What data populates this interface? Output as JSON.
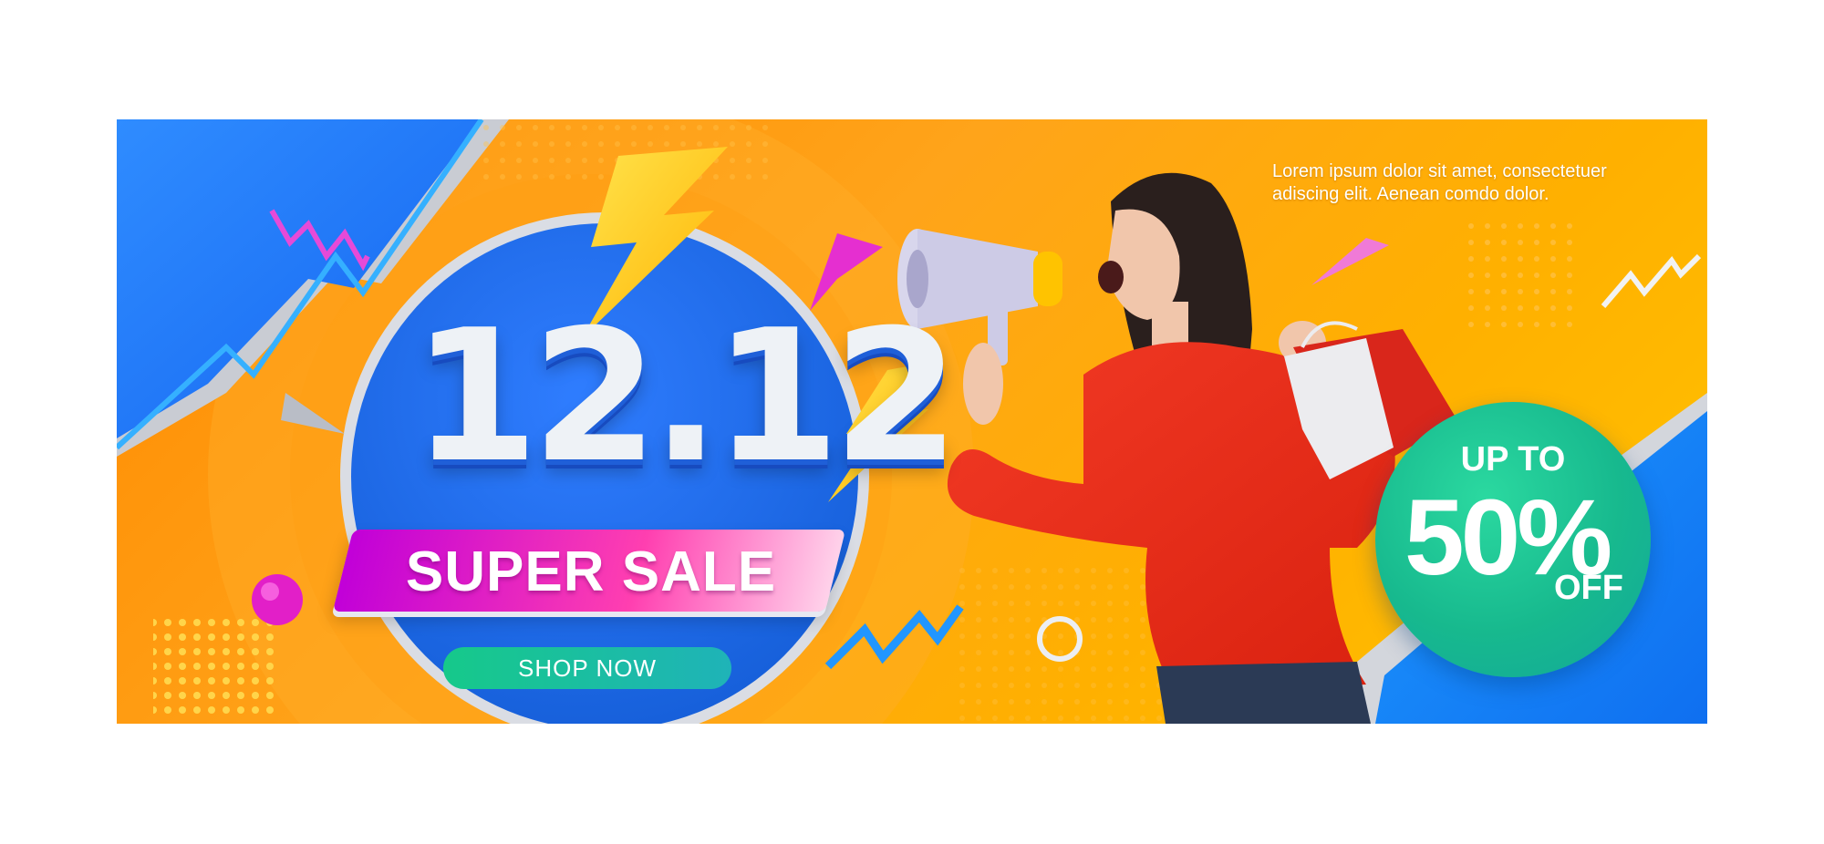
{
  "banner": {
    "lorem_text": "Lorem ipsum dolor sit amet, consectetuer adiscing elit. Aenean comdo dolor.",
    "date_text": "12.12",
    "sale_label": "SUPER SALE",
    "shop_button_label": "SHOP NOW",
    "promo": {
      "prefix": "UP TO",
      "percent": "50%",
      "suffix": "OFF"
    }
  },
  "colors": {
    "orange": "#ff9a00",
    "blue": "#1e7bff",
    "magenta": "#e21fc8",
    "teal": "#16c98a",
    "red_sweater": "#e8281c"
  },
  "icons": [
    "lightning-bolt-icon",
    "megaphone-icon",
    "zigzag-icon",
    "pyramid-icon",
    "sphere-icon",
    "ring-icon",
    "dot-grid-icon",
    "shopping-bag-icon"
  ]
}
